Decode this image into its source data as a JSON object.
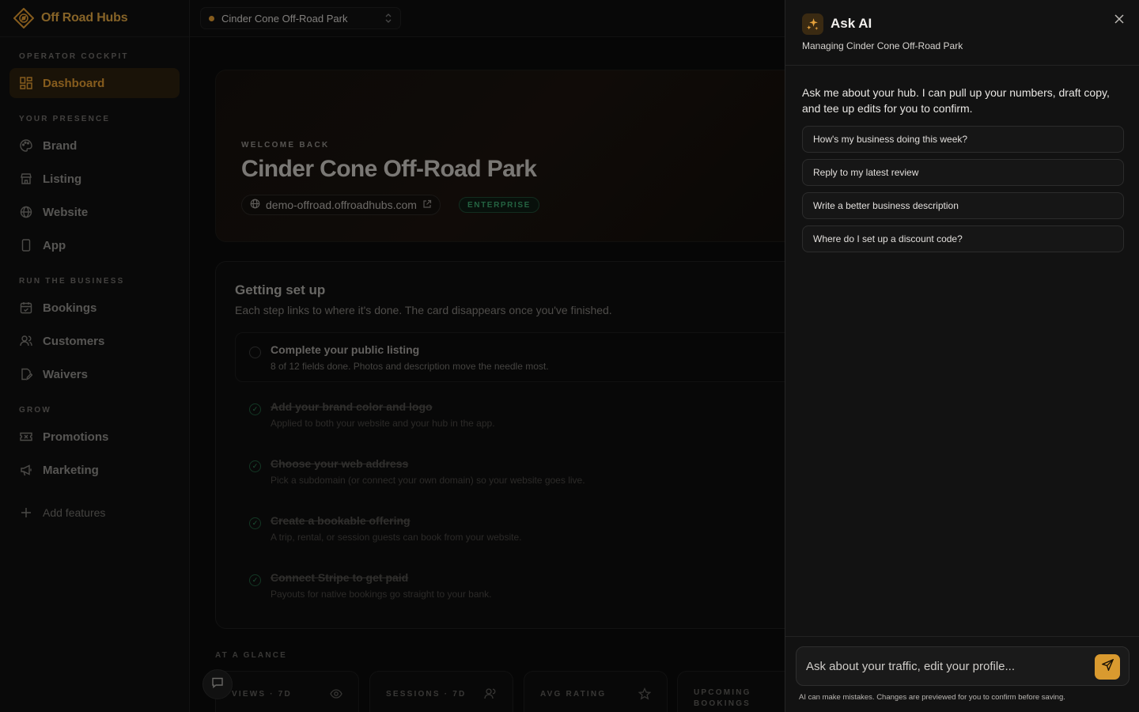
{
  "brand": {
    "name": "Off Road Hubs",
    "accent": "#d99530"
  },
  "topbar": {
    "park_select": "Cinder Cone Off-Road Park"
  },
  "sidebar": {
    "sections": {
      "operator": "OPERATOR COCKPIT",
      "presence": "YOUR PRESENCE",
      "business": "RUN THE BUSINESS",
      "grow": "GROW"
    },
    "items": {
      "dashboard": "Dashboard",
      "brand": "Brand",
      "listing": "Listing",
      "website": "Website",
      "app": "App",
      "bookings": "Bookings",
      "customers": "Customers",
      "waivers": "Waivers",
      "promotions": "Promotions",
      "marketing": "Marketing",
      "add_features": "Add features"
    }
  },
  "hero": {
    "eyebrow": "WELCOME BACK",
    "title": "Cinder Cone Off-Road Park",
    "domain": "demo-offroad.offroadhubs.com",
    "plan_badge": "ENTERPRISE"
  },
  "setup": {
    "title": "Getting set up",
    "subtitle": "Each step links to where it's done. The card disappears once you've finished.",
    "steps": [
      {
        "title": "Complete your public listing",
        "desc": "8 of 12 fields done. Photos and description move the needle most.",
        "done": false
      },
      {
        "title": "Add your brand color and logo",
        "desc": "Applied to both your website and your hub in the app.",
        "done": true
      },
      {
        "title": "Choose your web address",
        "desc": "Pick a subdomain (or connect your own domain) so your website goes live.",
        "done": true
      },
      {
        "title": "Create a bookable offering",
        "desc": "A trip, rental, or session guests can book from your website.",
        "done": true
      },
      {
        "title": "Connect Stripe to get paid",
        "desc": "Payouts for native bookings go straight to your bank.",
        "done": true
      }
    ]
  },
  "glance": {
    "label": "AT A GLANCE",
    "cards": {
      "views": "VIEWS · 7D",
      "sessions": "SESSIONS · 7D",
      "rating": "AVG RATING",
      "upcoming_1": "UPCOMING",
      "upcoming_2": "BOOKINGS"
    }
  },
  "ai": {
    "title": "Ask AI",
    "subtitle": "Managing Cinder Cone Off-Road Park",
    "intro": "Ask me about your hub. I can pull up your numbers, draft copy, and tee up edits for you to confirm.",
    "suggestions": [
      "How's my business doing this week?",
      "Reply to my latest review",
      "Write a better business description",
      "Where do I set up a discount code?"
    ],
    "input_placeholder": "Ask about your traffic, edit your profile...",
    "disclaimer": "AI can make mistakes. Changes are previewed for you to confirm before saving."
  }
}
